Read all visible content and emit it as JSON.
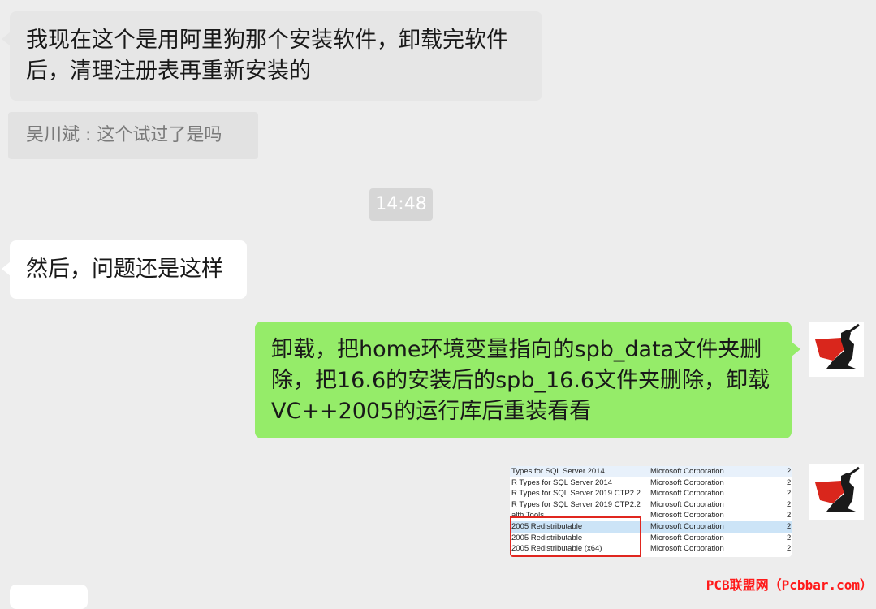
{
  "messages": {
    "m1_line1": "我现在这个是用阿里狗那个安装软件，卸载完软件",
    "m1_line2": "后，清理注册表再重新安装的",
    "quote": "吴川斌 : 这个试过了是吗",
    "time": "14:48",
    "m2": "然后，问题还是这样",
    "m3_line1": "卸载，把home环境变量指向的spb_data文件夹删",
    "m3_line2": "除，把16.6的安装后的spb_16.6文件夹删除，卸载",
    "m3_line3": "VC++2005的运行库后重装看看"
  },
  "screenshot": {
    "rows": [
      {
        "name": "Types for SQL Server 2014",
        "publisher": "Microsoft Corporation",
        "extra": "2"
      },
      {
        "name": "R Types for SQL Server 2014",
        "publisher": "Microsoft Corporation",
        "extra": "2"
      },
      {
        "name": "R Types for SQL Server 2019 CTP2.2",
        "publisher": "Microsoft Corporation",
        "extra": "2"
      },
      {
        "name": "R Types for SQL Server 2019 CTP2.2",
        "publisher": "Microsoft Corporation",
        "extra": "2"
      },
      {
        "name": "alth Tools",
        "publisher": "Microsoft Corporation",
        "extra": "2"
      },
      {
        "name": "2005 Redistributable",
        "publisher": "Microsoft Corporation",
        "extra": "2"
      },
      {
        "name": "2005 Redistributable",
        "publisher": "Microsoft Corporation",
        "extra": "2"
      },
      {
        "name": "2005 Redistributable (x64)",
        "publisher": "Microsoft Corporation",
        "extra": "2"
      }
    ]
  },
  "watermark": "PCB联盟网（Pcbbar.com）",
  "colors": {
    "background": "#ededed",
    "self_bubble": "#95ec69",
    "other_bubble": "#ffffff",
    "highlight_box": "#e0261f",
    "watermark": "#ff1a1a"
  },
  "icons": {
    "avatar": "caped-figure-avatar-icon"
  }
}
